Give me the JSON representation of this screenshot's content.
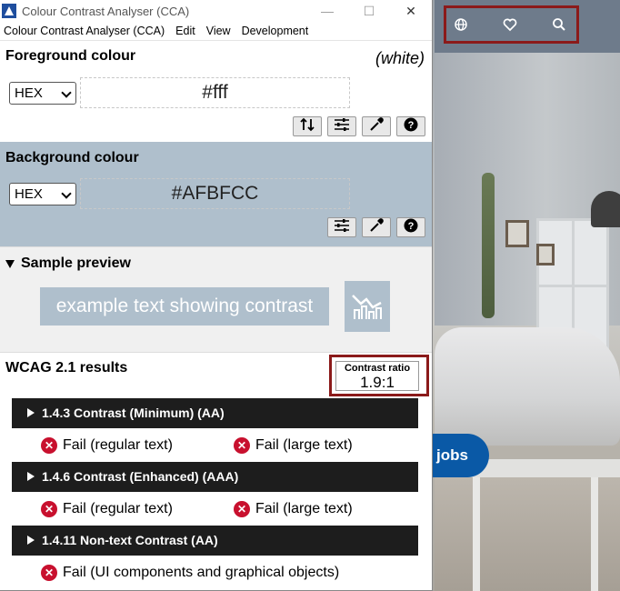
{
  "window": {
    "title": "Colour Contrast Analyser (CCA)",
    "controls": {
      "minimize": "—",
      "maximize": "☐",
      "close": "✕"
    }
  },
  "menu": [
    "Colour Contrast Analyser (CCA)",
    "Edit",
    "View",
    "Development"
  ],
  "foreground": {
    "title": "Foreground colour",
    "colour_name": "(white)",
    "format": "HEX",
    "value": "#fff",
    "tools": [
      "swap-icon",
      "sliders-icon",
      "eyedropper-icon",
      "help-icon"
    ]
  },
  "background": {
    "title": "Background colour",
    "format": "HEX",
    "value": "#AFBFCC",
    "color": "#AFBFCC",
    "tools": [
      "sliders-icon",
      "eyedropper-icon",
      "help-icon"
    ]
  },
  "preview": {
    "title": "Sample preview",
    "text": "example text showing contrast"
  },
  "results": {
    "title": "WCAG 2.1 results",
    "ratio_label": "Contrast ratio",
    "ratio_value": "1.9:1",
    "criteria": [
      {
        "label": "1.4.3 Contrast (Minimum) (AA)",
        "results": [
          "Fail (regular text)",
          "Fail (large text)"
        ]
      },
      {
        "label": "1.4.6 Contrast (Enhanced) (AAA)",
        "results": [
          "Fail (regular text)",
          "Fail (large text)"
        ]
      },
      {
        "label": "1.4.11 Non-text Contrast (AA)",
        "results": [
          "Fail (UI components and graphical objects)"
        ]
      }
    ]
  },
  "website": {
    "jobs_button": "jobs",
    "header_icons": [
      "globe-icon",
      "heart-icon",
      "search-icon"
    ]
  },
  "colors": {
    "fail": "#c8102e",
    "highlight_border": "#8b1a1a",
    "jobs_button": "#0a59a6"
  }
}
